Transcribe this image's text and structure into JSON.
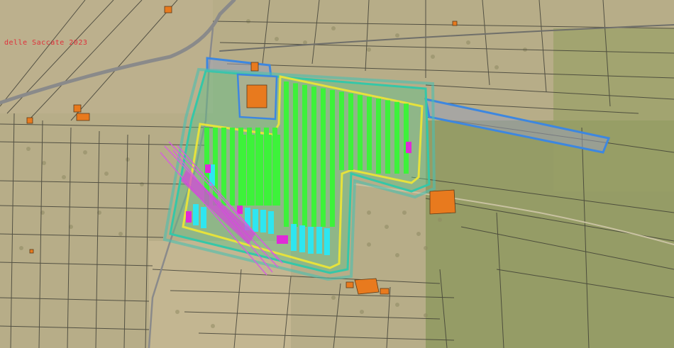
{
  "map": {
    "label": "delle Saccate 2023"
  },
  "legend_colors": {
    "aerial_base": "#b9ae8a",
    "parcel_lines": "#3a3a32",
    "road": "#8a8a8a",
    "site_boundary": "#3d87e0",
    "buffer_zone": "#35c7a8",
    "fence_line": "#e6e23c",
    "panel_rows_green": "#3df23a",
    "panel_rows_cyan": "#2ee6f0",
    "panel_blocks_magenta": "#e02ad8",
    "buildings": "#e87a1e",
    "power_line": "#d85ce0",
    "map_label": "#e0303a"
  }
}
